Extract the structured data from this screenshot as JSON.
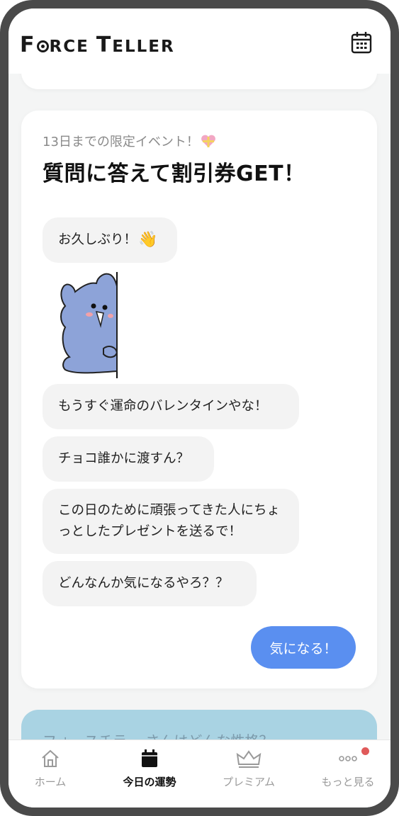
{
  "app": {
    "logo_text": "FORCE TELLER"
  },
  "event_card": {
    "event_label": "13日までの限定イベント！",
    "headline": "質問に答えて割引券GET！",
    "messages": [
      "お久しぶり！",
      "もうすぐ運命のバレンタインやな！",
      "チョコ誰かに渡すん？",
      "この日のために頑張ってきた人にちょっとしたプレゼントを送るで！",
      "どんなんか気になるやろ？？"
    ],
    "wave_emoji": "👋",
    "cta_label": "気になる！"
  },
  "next_card": {
    "text": "フォースチラー さんはどんな性格？"
  },
  "tabbar": {
    "items": [
      {
        "label": "ホーム",
        "icon": "home-icon"
      },
      {
        "label": "今日の運勢",
        "icon": "calendar-icon"
      },
      {
        "label": "プレミアム",
        "icon": "crown-icon"
      },
      {
        "label": "もっと見る",
        "icon": "more-icon"
      }
    ],
    "active_index": 1
  },
  "colors": {
    "accent": "#5a8ff0",
    "badge": "#e05a5a"
  }
}
